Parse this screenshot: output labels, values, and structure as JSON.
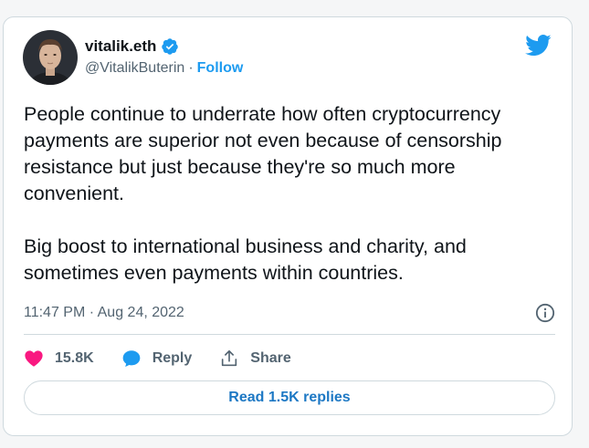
{
  "author": {
    "display_name": "vitalik.eth",
    "handle": "@VitalikButerin",
    "separator": "·",
    "follow_label": "Follow"
  },
  "tweet": {
    "text": "People continue to underrate how often cryptocurrency payments are superior not even because of censorship resistance but just because they're so much more convenient.\n\nBig boost to international business and charity, and sometimes even payments within countries.",
    "timestamp": "11:47 PM · Aug 24, 2022"
  },
  "actions": {
    "likes": "15.8K",
    "reply_label": "Reply",
    "share_label": "Share"
  },
  "read_replies_label": "Read 1.5K replies",
  "colors": {
    "accent": "#1d9bf0",
    "like": "#f91880",
    "text": "#0f1419",
    "muted": "#536471",
    "border": "#cfd9de"
  },
  "icons": [
    "verified-badge-icon",
    "twitter-bird-icon",
    "info-icon",
    "heart-icon",
    "reply-bubble-icon",
    "share-icon"
  ]
}
